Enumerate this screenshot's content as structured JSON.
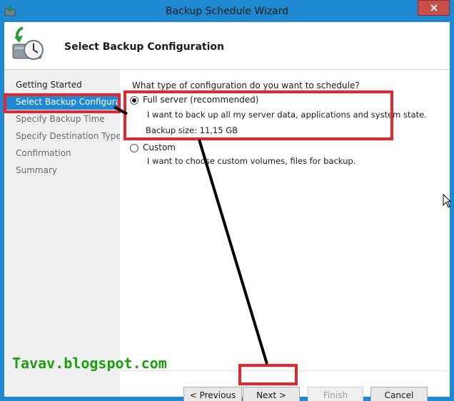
{
  "window": {
    "title": "Backup Schedule Wizard",
    "close_icon": "close-icon"
  },
  "header": {
    "title": "Select Backup Configuration",
    "icon": "backup-clock-icon"
  },
  "nav": {
    "items": [
      {
        "label": "Getting Started",
        "state": "enabled"
      },
      {
        "label": "Select Backup Configurat...",
        "state": "selected"
      },
      {
        "label": "Specify Backup Time",
        "state": "disabled"
      },
      {
        "label": "Specify Destination Type",
        "state": "disabled"
      },
      {
        "label": "Confirmation",
        "state": "disabled"
      },
      {
        "label": "Summary",
        "state": "disabled"
      }
    ]
  },
  "content": {
    "question": "What type of configuration do you want to schedule?",
    "options": [
      {
        "label": "Full server (recommended)",
        "description": "I want to back up all my server data, applications and system state.",
        "size": "Backup size: 11,15 GB",
        "selected": true
      },
      {
        "label": "Custom",
        "description": "I want to choose custom volumes, files for backup.",
        "selected": false
      }
    ]
  },
  "buttons": {
    "previous": "< Previous",
    "next": "Next >",
    "finish": "Finish",
    "cancel": "Cancel"
  },
  "watermark": "Tavav.blogspot.com",
  "colors": {
    "titlebar": "#1e88d0",
    "selected_nav": "#1f89d6",
    "highlight": "#e8242c",
    "watermark": "#1d9e12"
  }
}
